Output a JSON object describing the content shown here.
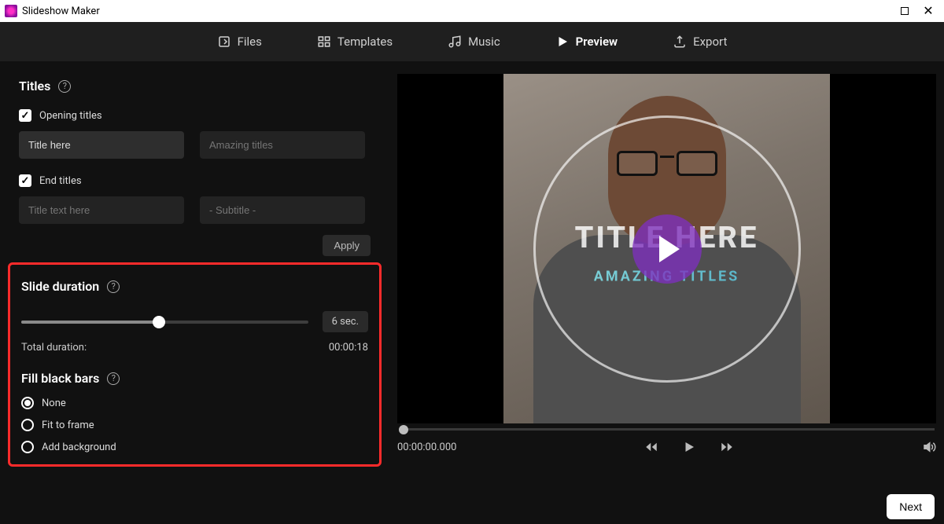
{
  "window": {
    "title": "Slideshow Maker"
  },
  "nav": {
    "files": "Files",
    "templates": "Templates",
    "music": "Music",
    "preview": "Preview",
    "export": "Export"
  },
  "titles": {
    "section": "Titles",
    "opening_label": "Opening titles",
    "end_label": "End titles",
    "opening_input": "Title here",
    "opening_subtitle_placeholder": "Amazing titles",
    "end_input_placeholder": "Title text here",
    "end_subtitle_placeholder": "- Subtitle -",
    "apply": "Apply"
  },
  "duration": {
    "section": "Slide duration",
    "value_label": "6 sec.",
    "slider_percent": 48,
    "total_label": "Total duration:",
    "total_value": "00:00:18"
  },
  "fill": {
    "section": "Fill black bars",
    "none": "None",
    "fit": "Fit to frame",
    "addbg": "Add background"
  },
  "preview": {
    "overlay_title": "TITLE HERE",
    "overlay_sub": "AMAZING TITLES",
    "timecode": "00:00:00.000"
  },
  "footer": {
    "next": "Next"
  }
}
